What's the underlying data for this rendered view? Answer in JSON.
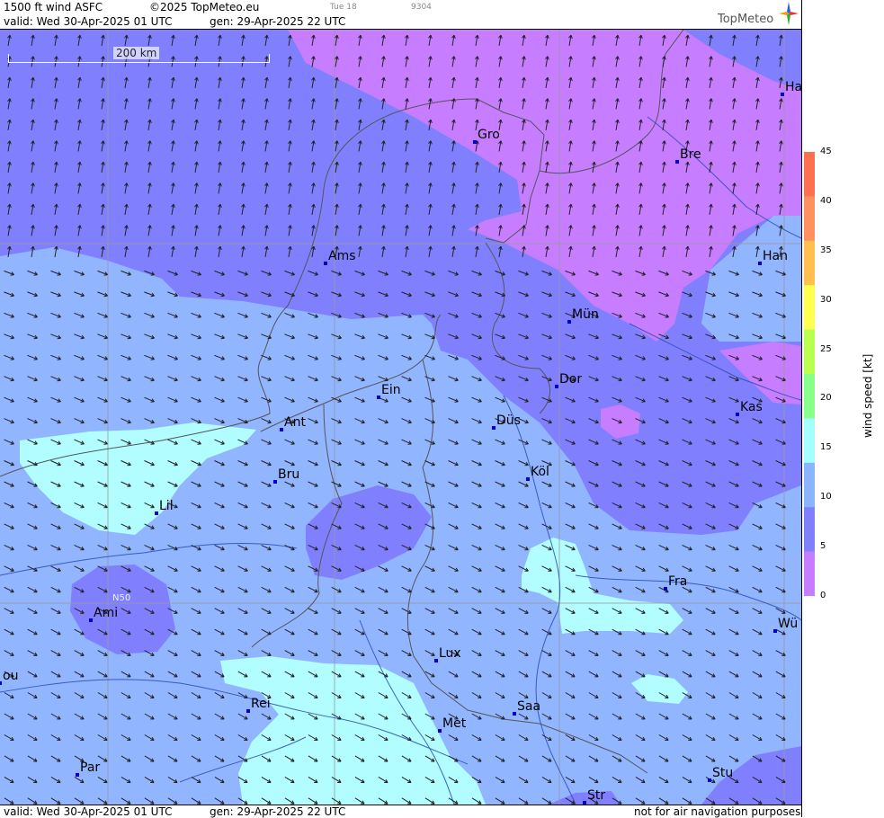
{
  "header": {
    "title": "1500 ft wind ASFC",
    "copyright": "©2025 TopMeteo.eu",
    "day_tag": "Tue 18",
    "code": "9304",
    "valid": "valid:  Wed  30-Apr-2025  01 UTC",
    "gen": "gen: 29-Apr-2025 22 UTC",
    "logo": "TopMeteo"
  },
  "footer": {
    "valid": "valid:  Wed  30-Apr-2025  01 UTC",
    "gen": "gen: 29-Apr-2025 22 UTC",
    "disclaimer": "not for air navigation purposes"
  },
  "scale": {
    "label": "200 km"
  },
  "grid_label": "N50",
  "legend": {
    "title": "wind  speed  [kt]",
    "ticks": [
      "0",
      "5",
      "10",
      "15",
      "20",
      "25",
      "30",
      "35",
      "40",
      "45"
    ],
    "colors": [
      "#c77dff",
      "#8080ff",
      "#8bb4ff",
      "#a5ffff",
      "#8aff8a",
      "#b8ff50",
      "#ffff50",
      "#ffc050",
      "#ff9060",
      "#ff7050"
    ]
  },
  "colors": {
    "violet": "#c77dff",
    "purple": "#8080ff",
    "lightblue": "#92b5ff",
    "cyan": "#b2fdff",
    "boundary": "#555555",
    "river": "#2a4ab5",
    "grid": "#999999"
  },
  "cities": [
    {
      "name": "Gro"
    },
    {
      "name": "Bre"
    },
    {
      "name": "Ha"
    },
    {
      "name": "Ams"
    },
    {
      "name": "Han"
    },
    {
      "name": "Mün"
    },
    {
      "name": "Dor"
    },
    {
      "name": "Ein"
    },
    {
      "name": "Kas"
    },
    {
      "name": "Ant"
    },
    {
      "name": "Düs"
    },
    {
      "name": "Bru"
    },
    {
      "name": "Köl"
    },
    {
      "name": "Lil"
    },
    {
      "name": "Fra"
    },
    {
      "name": "Ami"
    },
    {
      "name": "Wü"
    },
    {
      "name": "Lux"
    },
    {
      "name": "ou"
    },
    {
      "name": "Rei"
    },
    {
      "name": "Saa"
    },
    {
      "name": "Met"
    },
    {
      "name": "Par"
    },
    {
      "name": "Stu"
    },
    {
      "name": "Str"
    }
  ]
}
